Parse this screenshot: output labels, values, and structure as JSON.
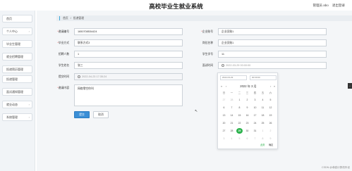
{
  "header": {
    "title": "高校毕业生就业系统",
    "user_label": "管理员 abo",
    "logout_label": "退出登录"
  },
  "sidebar": {
    "items": [
      {
        "label": "首页"
      },
      {
        "label": "个人中心"
      },
      {
        "label": "毕业生管理"
      },
      {
        "label": "就业招聘管理"
      },
      {
        "label": "投递简历管理"
      },
      {
        "label": "投递管理"
      },
      {
        "label": "面试通知管理"
      },
      {
        "label": "就业动态"
      },
      {
        "label": "系统管理"
      }
    ]
  },
  "breadcrumb": {
    "home": "首页",
    "separator": "/",
    "current": "投递管理"
  },
  "form": {
    "fields": {
      "job_id": {
        "label": "邀请编号",
        "value": "1650708534424"
      },
      "company_account": {
        "label": "企业账号",
        "value": "企业员账1"
      },
      "student_contact": {
        "label": "毕业方式",
        "value": "联系方式3"
      },
      "position": {
        "label": "岗位名称",
        "value": "企业员账1"
      },
      "student_account": {
        "label": "招聘人数",
        "value": "1"
      },
      "student_number": {
        "label": "学生学号",
        "value": "11"
      },
      "student_name": {
        "label": "学生姓名",
        "value": "张三"
      },
      "interview_time": {
        "label": "面试时间",
        "placeholder": "2022-03-29 00:00:00"
      },
      "submit_time": {
        "label": "提交时间",
        "value": "2022-04-23 17:35:24"
      },
      "content": {
        "label": "邀请内容",
        "value": "网络零空你叫"
      }
    },
    "submit_label": "提交",
    "cancel_label": "取消"
  },
  "datepicker": {
    "date_input": "2022-03-29",
    "time_input": "00:00:00",
    "prev_year": "«",
    "prev_month": "‹",
    "next_month": "›",
    "next_year": "»",
    "month_label": "2022 年  3 月",
    "weekdays": [
      "日",
      "一",
      "二",
      "三",
      "四",
      "五",
      "六"
    ],
    "days": [
      [
        "27",
        "28",
        "1",
        "2",
        "3",
        "4",
        "5"
      ],
      [
        "6",
        "7",
        "8",
        "9",
        "10",
        "11",
        "12"
      ],
      [
        "13",
        "14",
        "15",
        "16",
        "17",
        "18",
        "19"
      ],
      [
        "20",
        "21",
        "22",
        "23",
        "24",
        "25",
        "26"
      ],
      [
        "27",
        "28",
        "29",
        "30",
        "31",
        "1",
        "2"
      ],
      [
        "3",
        "4",
        "5",
        "6",
        "7",
        "8",
        "9"
      ]
    ],
    "selected_day": "29",
    "now_label": "此刻",
    "confirm_label": "确定"
  },
  "watermark": "CSDN @卓越计算机毕设"
}
